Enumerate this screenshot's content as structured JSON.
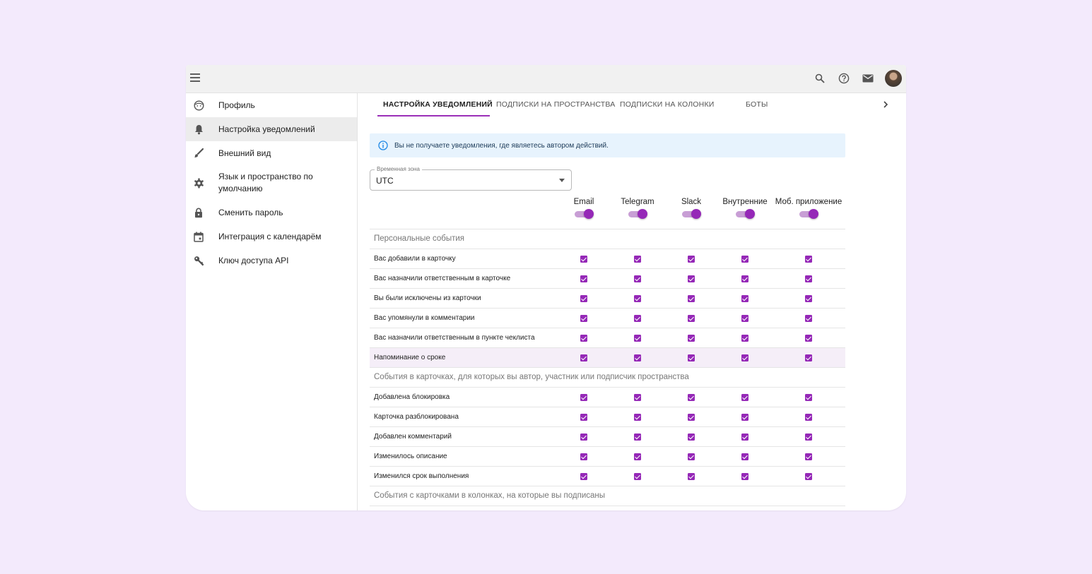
{
  "topbar": {
    "menu_icon": "menu-icon",
    "icons": [
      "search-icon",
      "help-icon",
      "mail-icon",
      "avatar"
    ]
  },
  "sidebar": {
    "items": [
      {
        "label": "Профиль",
        "icon": "face-icon"
      },
      {
        "label": "Настройка уведомлений",
        "icon": "bell-icon",
        "active": true
      },
      {
        "label": "Внешний вид",
        "icon": "brush-icon"
      },
      {
        "label": "Язык и пространство по умолчанию",
        "icon": "gear-icon"
      },
      {
        "label": "Сменить пароль",
        "icon": "lock-icon"
      },
      {
        "label": "Интеграция с календарём",
        "icon": "calendar-icon"
      },
      {
        "label": "Ключ доступа API",
        "icon": "key-icon"
      }
    ]
  },
  "tabs": [
    {
      "label": "НАСТРОЙКА УВЕДОМЛЕНИЙ",
      "active": true
    },
    {
      "label": "ПОДПИСКИ НА ПРОСТРАНСТВА"
    },
    {
      "label": "ПОДПИСКИ НА КОЛОНКИ"
    },
    {
      "label": "БОТЫ"
    }
  ],
  "info": {
    "text": "Вы не получаете уведомления, где являетесь автором действий.",
    "icon": "info-icon"
  },
  "timezone": {
    "label": "Временная зона",
    "value": "UTC"
  },
  "columns": [
    "Email",
    "Telegram",
    "Slack",
    "Внутренние",
    "Моб. приложение"
  ],
  "column_toggles": [
    true,
    true,
    true,
    true,
    true
  ],
  "sections": [
    {
      "title": "Персональные события",
      "rows": [
        {
          "label": "Вас добавили в карточку",
          "checks": [
            true,
            true,
            true,
            true,
            true
          ]
        },
        {
          "label": "Вас назначили ответственным в карточке",
          "checks": [
            true,
            true,
            true,
            true,
            true
          ]
        },
        {
          "label": "Вы были исключены из карточки",
          "checks": [
            true,
            true,
            true,
            true,
            true
          ]
        },
        {
          "label": "Вас упомянули в комментарии",
          "checks": [
            true,
            true,
            true,
            true,
            true
          ]
        },
        {
          "label": "Вас назначили ответственным в пункте чеклиста",
          "checks": [
            true,
            true,
            true,
            true,
            true
          ]
        },
        {
          "label": "Напоминание о сроке",
          "checks": [
            true,
            true,
            true,
            true,
            true
          ]
        }
      ]
    },
    {
      "title": "События в карточках, для которых вы автор, участник или подписчик пространства",
      "rows": [
        {
          "label": "Добавлена блокировка",
          "checks": [
            true,
            true,
            true,
            true,
            true
          ]
        },
        {
          "label": "Карточка разблокирована",
          "checks": [
            true,
            true,
            true,
            true,
            true
          ]
        },
        {
          "label": "Добавлен комментарий",
          "checks": [
            true,
            true,
            true,
            true,
            true
          ]
        },
        {
          "label": "Изменилось описание",
          "checks": [
            true,
            true,
            true,
            true,
            true
          ]
        },
        {
          "label": "Изменился срок выполнения",
          "checks": [
            true,
            true,
            true,
            true,
            true
          ]
        }
      ]
    },
    {
      "title": "События с карточками в колонках, на которые вы подписаны",
      "rows": []
    }
  ],
  "colors": {
    "accent": "#9528b7",
    "accent_light": "#c89ed5",
    "page_bg": "#f3eafc",
    "info_bg": "#e7f3fd",
    "highlight_row": "#f5eef8"
  }
}
